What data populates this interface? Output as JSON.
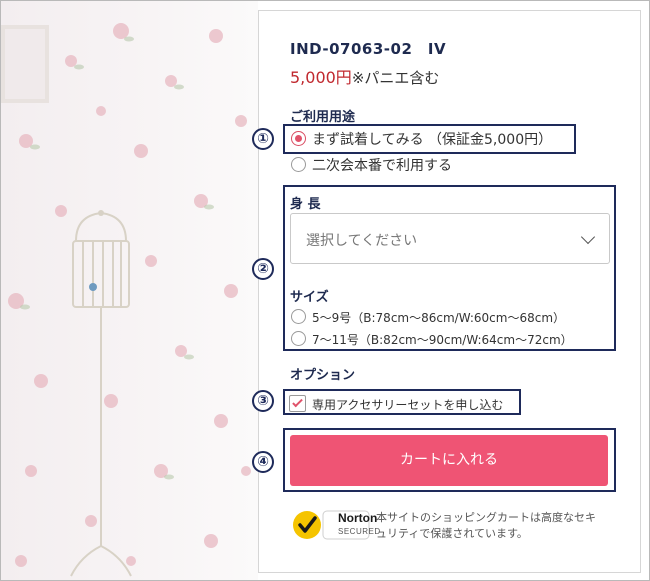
{
  "product": {
    "code": "IND-07063-02　IV",
    "price": "5,000円",
    "price_note": "※パニエ含む"
  },
  "usage": {
    "label": "ご利用用途",
    "options": [
      {
        "label": "まず試着してみる （保証金5,000円）",
        "checked": true
      },
      {
        "label": "二次会本番で利用する",
        "checked": false
      }
    ]
  },
  "height": {
    "label": "身 長",
    "placeholder": "選択してください"
  },
  "size": {
    "label": "サイズ",
    "options": [
      {
        "label": "5～9号（B:78cm～86cm/W:60cm～68cm）",
        "checked": false
      },
      {
        "label": "7～11号（B:82cm～90cm/W:64cm～72cm）",
        "checked": false
      }
    ]
  },
  "option": {
    "label": "オプション",
    "checkbox_label": "専用アクセサリーセットを申し込む",
    "checked": true
  },
  "cart_button": "カートに入れる",
  "norton": {
    "brand": "Norton",
    "secured": "SECURED",
    "text": "本サイトのショッピングカートは高度なセキュリティで保護されています。"
  },
  "annotations": [
    "①",
    "②",
    "③",
    "④"
  ],
  "colors": {
    "accent": "#ef5474",
    "price": "#c0282e",
    "navy": "#1e2a5a",
    "norton_yellow": "#f5c400"
  }
}
